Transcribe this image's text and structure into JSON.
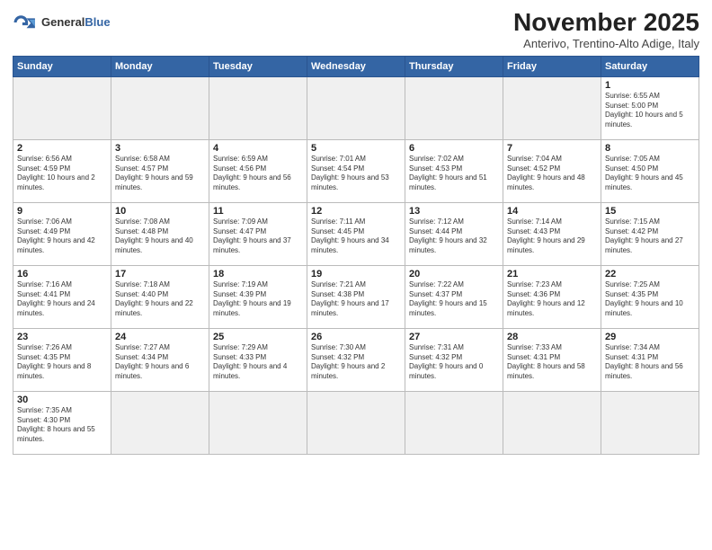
{
  "header": {
    "logo_general": "General",
    "logo_blue": "Blue",
    "month_title": "November 2025",
    "subtitle": "Anterivo, Trentino-Alto Adige, Italy"
  },
  "weekdays": [
    "Sunday",
    "Monday",
    "Tuesday",
    "Wednesday",
    "Thursday",
    "Friday",
    "Saturday"
  ],
  "weeks": [
    [
      {
        "day": "",
        "info": "",
        "empty": true
      },
      {
        "day": "",
        "info": "",
        "empty": true
      },
      {
        "day": "",
        "info": "",
        "empty": true
      },
      {
        "day": "",
        "info": "",
        "empty": true
      },
      {
        "day": "",
        "info": "",
        "empty": true
      },
      {
        "day": "",
        "info": "",
        "empty": true
      },
      {
        "day": "1",
        "info": "Sunrise: 6:55 AM\nSunset: 5:00 PM\nDaylight: 10 hours and 5 minutes."
      }
    ],
    [
      {
        "day": "2",
        "info": "Sunrise: 6:56 AM\nSunset: 4:59 PM\nDaylight: 10 hours and 2 minutes."
      },
      {
        "day": "3",
        "info": "Sunrise: 6:58 AM\nSunset: 4:57 PM\nDaylight: 9 hours and 59 minutes."
      },
      {
        "day": "4",
        "info": "Sunrise: 6:59 AM\nSunset: 4:56 PM\nDaylight: 9 hours and 56 minutes."
      },
      {
        "day": "5",
        "info": "Sunrise: 7:01 AM\nSunset: 4:54 PM\nDaylight: 9 hours and 53 minutes."
      },
      {
        "day": "6",
        "info": "Sunrise: 7:02 AM\nSunset: 4:53 PM\nDaylight: 9 hours and 51 minutes."
      },
      {
        "day": "7",
        "info": "Sunrise: 7:04 AM\nSunset: 4:52 PM\nDaylight: 9 hours and 48 minutes."
      },
      {
        "day": "8",
        "info": "Sunrise: 7:05 AM\nSunset: 4:50 PM\nDaylight: 9 hours and 45 minutes."
      }
    ],
    [
      {
        "day": "9",
        "info": "Sunrise: 7:06 AM\nSunset: 4:49 PM\nDaylight: 9 hours and 42 minutes."
      },
      {
        "day": "10",
        "info": "Sunrise: 7:08 AM\nSunset: 4:48 PM\nDaylight: 9 hours and 40 minutes."
      },
      {
        "day": "11",
        "info": "Sunrise: 7:09 AM\nSunset: 4:47 PM\nDaylight: 9 hours and 37 minutes."
      },
      {
        "day": "12",
        "info": "Sunrise: 7:11 AM\nSunset: 4:45 PM\nDaylight: 9 hours and 34 minutes."
      },
      {
        "day": "13",
        "info": "Sunrise: 7:12 AM\nSunset: 4:44 PM\nDaylight: 9 hours and 32 minutes."
      },
      {
        "day": "14",
        "info": "Sunrise: 7:14 AM\nSunset: 4:43 PM\nDaylight: 9 hours and 29 minutes."
      },
      {
        "day": "15",
        "info": "Sunrise: 7:15 AM\nSunset: 4:42 PM\nDaylight: 9 hours and 27 minutes."
      }
    ],
    [
      {
        "day": "16",
        "info": "Sunrise: 7:16 AM\nSunset: 4:41 PM\nDaylight: 9 hours and 24 minutes."
      },
      {
        "day": "17",
        "info": "Sunrise: 7:18 AM\nSunset: 4:40 PM\nDaylight: 9 hours and 22 minutes."
      },
      {
        "day": "18",
        "info": "Sunrise: 7:19 AM\nSunset: 4:39 PM\nDaylight: 9 hours and 19 minutes."
      },
      {
        "day": "19",
        "info": "Sunrise: 7:21 AM\nSunset: 4:38 PM\nDaylight: 9 hours and 17 minutes."
      },
      {
        "day": "20",
        "info": "Sunrise: 7:22 AM\nSunset: 4:37 PM\nDaylight: 9 hours and 15 minutes."
      },
      {
        "day": "21",
        "info": "Sunrise: 7:23 AM\nSunset: 4:36 PM\nDaylight: 9 hours and 12 minutes."
      },
      {
        "day": "22",
        "info": "Sunrise: 7:25 AM\nSunset: 4:35 PM\nDaylight: 9 hours and 10 minutes."
      }
    ],
    [
      {
        "day": "23",
        "info": "Sunrise: 7:26 AM\nSunset: 4:35 PM\nDaylight: 9 hours and 8 minutes."
      },
      {
        "day": "24",
        "info": "Sunrise: 7:27 AM\nSunset: 4:34 PM\nDaylight: 9 hours and 6 minutes."
      },
      {
        "day": "25",
        "info": "Sunrise: 7:29 AM\nSunset: 4:33 PM\nDaylight: 9 hours and 4 minutes."
      },
      {
        "day": "26",
        "info": "Sunrise: 7:30 AM\nSunset: 4:32 PM\nDaylight: 9 hours and 2 minutes."
      },
      {
        "day": "27",
        "info": "Sunrise: 7:31 AM\nSunset: 4:32 PM\nDaylight: 9 hours and 0 minutes."
      },
      {
        "day": "28",
        "info": "Sunrise: 7:33 AM\nSunset: 4:31 PM\nDaylight: 8 hours and 58 minutes."
      },
      {
        "day": "29",
        "info": "Sunrise: 7:34 AM\nSunset: 4:31 PM\nDaylight: 8 hours and 56 minutes."
      }
    ],
    [
      {
        "day": "30",
        "info": "Sunrise: 7:35 AM\nSunset: 4:30 PM\nDaylight: 8 hours and 55 minutes."
      },
      {
        "day": "",
        "info": "",
        "empty": true
      },
      {
        "day": "",
        "info": "",
        "empty": true
      },
      {
        "day": "",
        "info": "",
        "empty": true
      },
      {
        "day": "",
        "info": "",
        "empty": true
      },
      {
        "day": "",
        "info": "",
        "empty": true
      },
      {
        "day": "",
        "info": "",
        "empty": true
      }
    ]
  ]
}
